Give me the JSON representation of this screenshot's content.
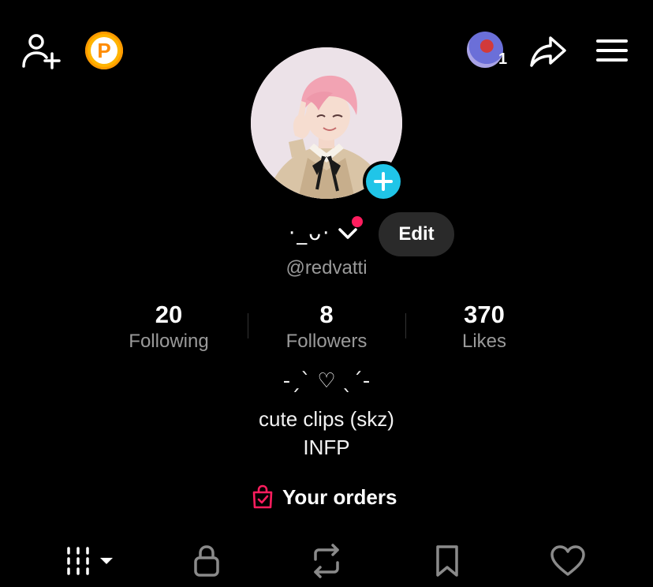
{
  "header": {
    "points_letter": "P",
    "story_count": "1"
  },
  "profile": {
    "display_name": "·_ᴗ·",
    "edit_label": "Edit",
    "username": "@redvatti"
  },
  "stats": [
    {
      "value": "20",
      "label": "Following"
    },
    {
      "value": "8",
      "label": "Followers"
    },
    {
      "value": "370",
      "label": "Likes"
    }
  ],
  "bio": {
    "line1": "-ˏˋ ♡ ˎˊ-",
    "line2": "cute clips (skz)",
    "line3": "INFP"
  },
  "orders": {
    "label": "Your orders"
  },
  "tabs": [
    {
      "icon": "grid-videos-icon"
    },
    {
      "icon": "lock-icon"
    },
    {
      "icon": "repost-icon"
    },
    {
      "icon": "bookmark-icon"
    },
    {
      "icon": "heart-icon"
    }
  ],
  "colors": {
    "background": "#000000",
    "accent_red": "#FF1D5E",
    "accent_cyan": "#20C5E8",
    "coin": "#FFB400"
  }
}
